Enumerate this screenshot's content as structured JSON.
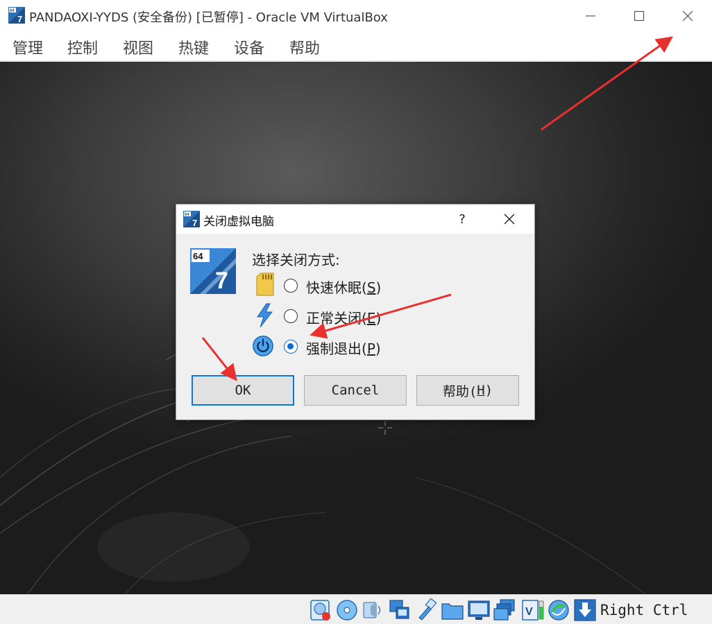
{
  "window": {
    "title": "PANDAOXI-YYDS (安全备份) [已暂停] - Oracle VM VirtualBox",
    "app_icon_badge": "64",
    "app_icon_number": "7"
  },
  "menu": [
    {
      "label": "管理"
    },
    {
      "label": "控制"
    },
    {
      "label": "视图"
    },
    {
      "label": "热键"
    },
    {
      "label": "设备"
    },
    {
      "label": "帮助"
    }
  ],
  "dialog": {
    "title": "关闭虚拟电脑",
    "help_glyph": "?",
    "os_badge": "64",
    "os_number": "7",
    "prompt": "选择关闭方式:",
    "options": [
      {
        "pre": "快速休眠(",
        "key": "S",
        "post": ")",
        "icon": "sd-card-icon",
        "checked": false
      },
      {
        "pre": "正常关闭(",
        "key": "E",
        "post": ")",
        "icon": "lightning-icon",
        "checked": false
      },
      {
        "pre": "强制退出(",
        "key": "P",
        "post": ")",
        "icon": "power-icon",
        "checked": true
      }
    ],
    "buttons": {
      "ok": "OK",
      "cancel": "Cancel",
      "help_pre": "帮助(",
      "help_key": "H",
      "help_post": ")"
    }
  },
  "statusbar": {
    "icons": [
      "hard-disk-icon",
      "optical-disc-icon",
      "audio-icon",
      "network-icon",
      "usb-icon",
      "shared-folder-icon",
      "display-icon",
      "capture-icon",
      "cpu-icon",
      "guest-additions-icon",
      "mouse-integration-icon"
    ],
    "host_key": "Right Ctrl"
  },
  "colors": {
    "accent": "#0a6ad8",
    "annotation_arrow": "#e8312f",
    "vm_background": "#2e2e2e"
  }
}
